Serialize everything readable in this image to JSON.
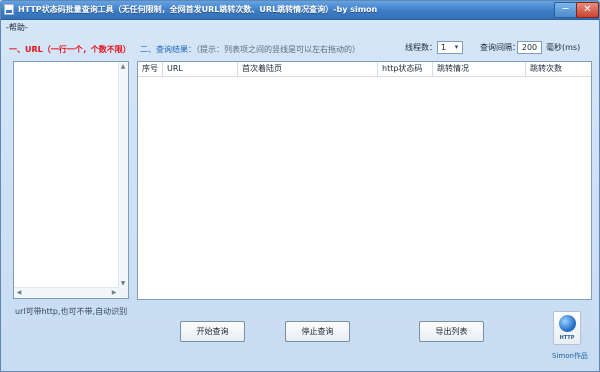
{
  "window": {
    "title": "HTTP状态码批量查询工具（无任何限制，全网首发URL跳转次数、URL跳转情况查询）-by simon",
    "min_glyph": "─",
    "close_glyph": "✕"
  },
  "menu": {
    "help": "-帮助-"
  },
  "left_panel": {
    "label": "一、URL（一行一个，个数不限）",
    "note": "url可带http,也可不带,自动识别"
  },
  "results": {
    "label": "二、查询结果：",
    "hint": "（提示：列表项之间的竖线是可以左右拖动的）",
    "columns": [
      "序号",
      "URL",
      "首次着陆页",
      "http状态码",
      "跳转情况",
      "跳转次数"
    ]
  },
  "settings": {
    "threads_label": "线程数：",
    "threads_value": "1",
    "interval_label": "查询间隔：",
    "interval_value": "200",
    "interval_unit": "毫秒(ms)"
  },
  "buttons": {
    "start": "开始查询",
    "stop": "停止查询",
    "export": "导出列表"
  },
  "branding": {
    "icon_text": "HTTP",
    "credit": "Simon作品"
  },
  "colors": {
    "title_bar": "#3d7cc6",
    "window_bg": "#cfe2f5",
    "label_red": "#e4131b",
    "label_blue": "#1d66ba"
  }
}
